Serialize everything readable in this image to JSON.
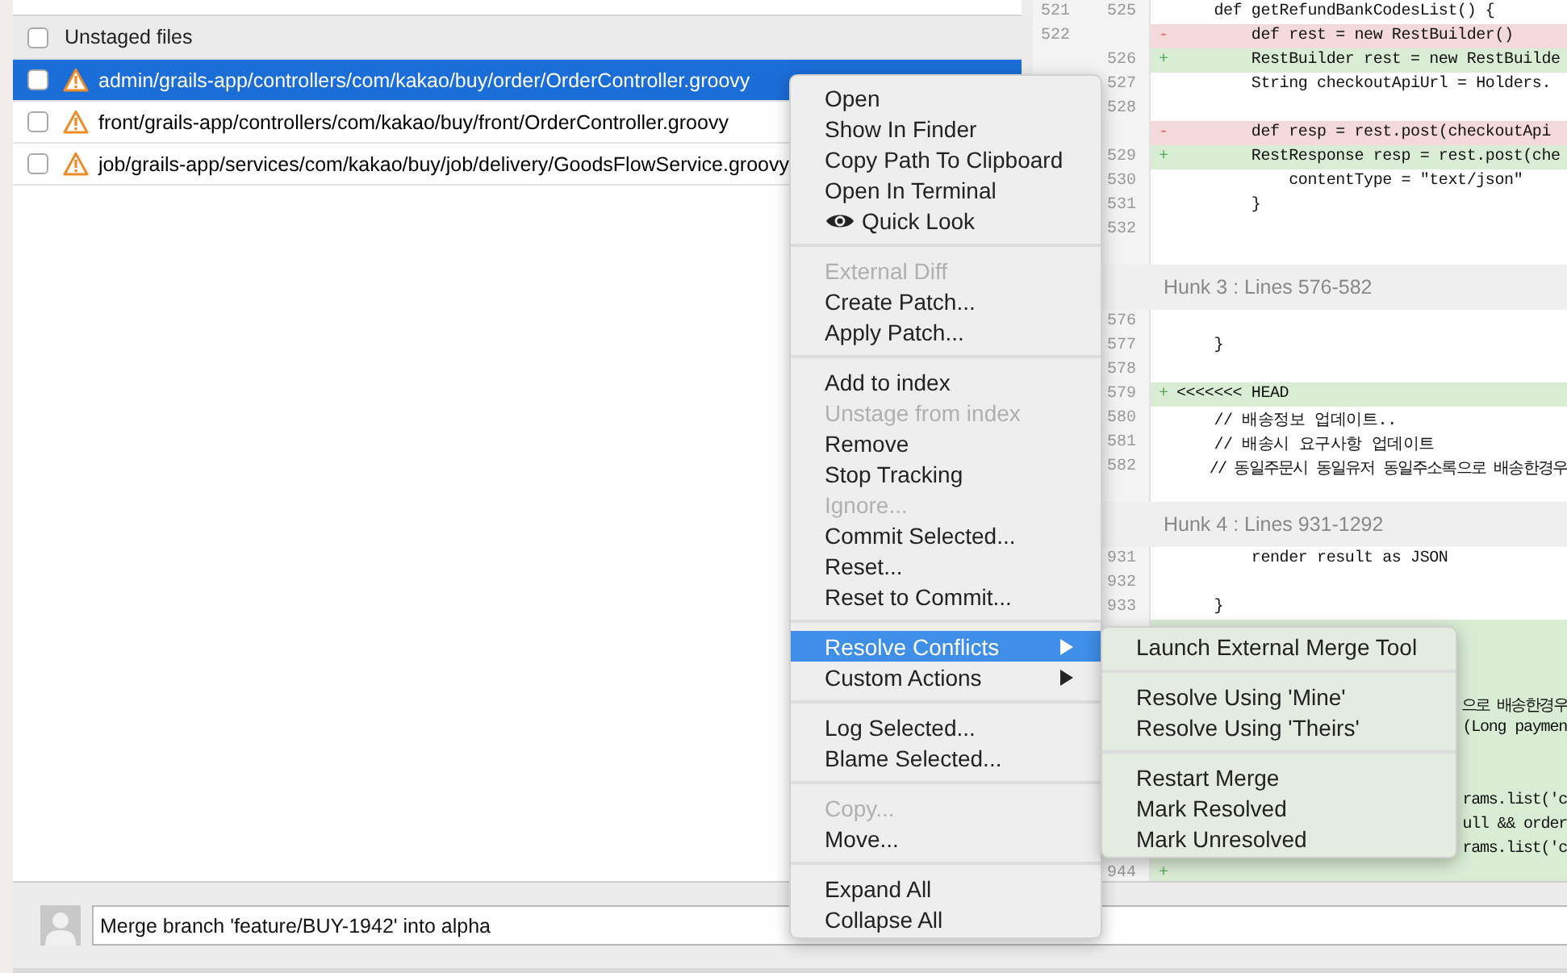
{
  "file_list": {
    "header": {
      "label": "Unstaged files",
      "checked": false
    },
    "files": [
      {
        "path": "admin/grails-app/controllers/com/kakao/buy/order/OrderController.groovy",
        "checked": false,
        "selected": true
      },
      {
        "path": "front/grails-app/controllers/com/kakao/buy/front/OrderController.groovy",
        "checked": false,
        "selected": false
      },
      {
        "path": "job/grails-app/services/com/kakao/buy/job/delivery/GoodsFlowService.groovy",
        "checked": false,
        "selected": false
      }
    ]
  },
  "diff": {
    "hunks": [
      {
        "lines": [
          {
            "old": "521",
            "new": "525",
            "kind": "context",
            "code": "    def getRefundBankCodesList() {"
          },
          {
            "old": "522",
            "kind": "removed",
            "marker": "-",
            "code": "        def rest = new RestBuilder()"
          },
          {
            "new": "526",
            "kind": "added",
            "marker": "+",
            "code": "        RestBuilder rest = new RestBuilde"
          },
          {
            "new": "527",
            "kind": "context",
            "code": "        String checkoutApiUrl = Holders."
          },
          {
            "new": "528",
            "kind": "context"
          },
          {
            "kind": "removed",
            "marker": "-",
            "code": "        def resp = rest.post(checkoutApi"
          },
          {
            "new": "529",
            "kind": "added",
            "marker": "+",
            "code": "        RestResponse resp = rest.post(che"
          },
          {
            "new": "530",
            "kind": "context",
            "code": "            contentType = \"text/json\""
          },
          {
            "new": "531",
            "kind": "context",
            "code": "        }"
          },
          {
            "new": "532",
            "kind": "context"
          }
        ]
      },
      {
        "header": "Hunk 3 : Lines 576-582",
        "lines": [
          {
            "new": "576",
            "kind": "context"
          },
          {
            "new": "577",
            "kind": "context",
            "code": "    }"
          },
          {
            "new": "578",
            "kind": "context"
          },
          {
            "new": "579",
            "kind": "added",
            "marker": "+",
            "code": "<<<<<<< HEAD"
          },
          {
            "new": "580",
            "kind": "context",
            "code": "    // 배송정보 업데이트.."
          },
          {
            "new": "581",
            "kind": "context",
            "code": "    // 배송시 요구사항 업데이트"
          },
          {
            "new": "582",
            "kind": "context",
            "code": "    // 동일주문시 동일유저 동일주소록으로 배송한경우"
          }
        ]
      },
      {
        "header": "Hunk 4 : Lines 931-1292",
        "lines": [
          {
            "new": "931",
            "kind": "context",
            "code": "        render result as JSON"
          },
          {
            "new": "932",
            "kind": "context"
          },
          {
            "new": "933",
            "kind": "context",
            "code": "    }"
          },
          {
            "kind": "added"
          },
          {
            "kind": "added"
          },
          {
            "kind": "added"
          },
          {
            "kind": "added",
            "tail": "으로 배송한경우"
          },
          {
            "kind": "added",
            "tail": "(Long paymen"
          },
          {
            "kind": "added"
          },
          {
            "kind": "added"
          },
          {
            "kind": "added",
            "tail": "rams.list('c"
          },
          {
            "kind": "added",
            "tail": "ull && order"
          },
          {
            "kind": "added",
            "tail": "rams.list('c"
          },
          {
            "new": "944",
            "kind": "added",
            "marker": "+"
          }
        ]
      }
    ]
  },
  "commit": {
    "message": "Merge branch 'feature/BUY-1942' into alpha"
  },
  "context_menu": {
    "items": [
      {
        "kind": "item",
        "label": "Open",
        "disabled": false,
        "selected": false
      },
      {
        "kind": "item",
        "label": "Show In Finder",
        "disabled": false,
        "selected": false
      },
      {
        "kind": "item",
        "label": "Copy Path To Clipboard",
        "disabled": false,
        "selected": false
      },
      {
        "kind": "item",
        "label": "Open In Terminal",
        "disabled": false,
        "selected": false
      },
      {
        "kind": "preview",
        "label": "Quick Look",
        "disabled": false,
        "selected": false
      },
      {
        "kind": "separator"
      },
      {
        "kind": "item",
        "label": "External Diff",
        "disabled": true,
        "selected": false
      },
      {
        "kind": "item",
        "label": "Create Patch...",
        "disabled": false,
        "selected": false
      },
      {
        "kind": "item",
        "label": "Apply Patch...",
        "disabled": false,
        "selected": false
      },
      {
        "kind": "separator"
      },
      {
        "kind": "item",
        "label": "Add to index",
        "disabled": false,
        "selected": false
      },
      {
        "kind": "item",
        "label": "Unstage from index",
        "disabled": true,
        "selected": false
      },
      {
        "kind": "item",
        "label": "Remove",
        "disabled": false,
        "selected": false
      },
      {
        "kind": "item",
        "label": "Stop Tracking",
        "disabled": false,
        "selected": false
      },
      {
        "kind": "item",
        "label": "Ignore...",
        "disabled": true,
        "selected": false
      },
      {
        "kind": "item",
        "label": "Commit Selected...",
        "disabled": false,
        "selected": false
      },
      {
        "kind": "item",
        "label": "Reset...",
        "disabled": false,
        "selected": false
      },
      {
        "kind": "item",
        "label": "Reset to Commit...",
        "disabled": false,
        "selected": false
      },
      {
        "kind": "separator"
      },
      {
        "kind": "submenu",
        "label": "Resolve Conflicts",
        "disabled": false,
        "selected": true
      },
      {
        "kind": "submenu",
        "label": "Custom Actions",
        "disabled": false,
        "selected": false
      },
      {
        "kind": "separator"
      },
      {
        "kind": "item",
        "label": "Log Selected...",
        "disabled": false,
        "selected": false
      },
      {
        "kind": "item",
        "label": "Blame Selected...",
        "disabled": false,
        "selected": false
      },
      {
        "kind": "separator"
      },
      {
        "kind": "item",
        "label": "Copy...",
        "disabled": true,
        "selected": false
      },
      {
        "kind": "item",
        "label": "Move...",
        "disabled": false,
        "selected": false
      },
      {
        "kind": "separator"
      },
      {
        "kind": "item",
        "label": "Expand All",
        "disabled": false,
        "selected": false
      },
      {
        "kind": "item",
        "label": "Collapse All",
        "disabled": false,
        "selected": false
      }
    ]
  },
  "submenu": {
    "items": [
      {
        "kind": "item",
        "label": "Launch External Merge Tool",
        "disabled": false,
        "selected": false
      },
      {
        "kind": "separator"
      },
      {
        "kind": "item",
        "label": "Resolve Using 'Mine'",
        "disabled": false,
        "selected": false
      },
      {
        "kind": "item",
        "label": "Resolve Using 'Theirs'",
        "disabled": false,
        "selected": false
      },
      {
        "kind": "separator"
      },
      {
        "kind": "item",
        "label": "Restart Merge",
        "disabled": false,
        "selected": false
      },
      {
        "kind": "item",
        "label": "Mark Resolved",
        "disabled": false,
        "selected": false
      },
      {
        "kind": "item",
        "label": "Mark Unresolved",
        "disabled": false,
        "selected": false
      }
    ]
  }
}
